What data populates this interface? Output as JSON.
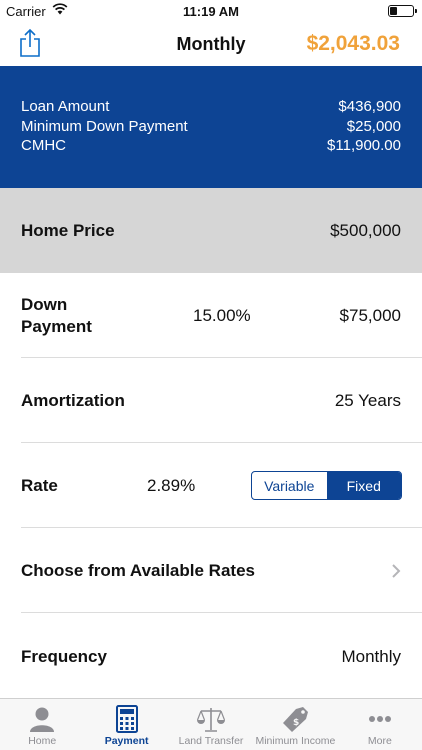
{
  "status_bar": {
    "carrier": "Carrier",
    "time": "11:19 AM",
    "battery_level": 0.3
  },
  "nav": {
    "share_icon": "share-icon",
    "title": "Monthly",
    "payment": "$2,043.03",
    "payment_color": "#f0a23a"
  },
  "summary": {
    "background": "#0d4494",
    "rows": [
      {
        "label": "Loan Amount",
        "value": "$436,900"
      },
      {
        "label": "Minimum Down Payment",
        "value": "$25,000"
      },
      {
        "label": "CMHC",
        "value": "$11,900.00"
      }
    ]
  },
  "home_price": {
    "label": "Home Price",
    "value": "$500,000"
  },
  "down_payment": {
    "label": "Down Payment",
    "percent": "15.00%",
    "value": "$75,000"
  },
  "amortization": {
    "label": "Amortization",
    "value": "25 Years"
  },
  "rate": {
    "label": "Rate",
    "value": "2.89%",
    "options": [
      "Variable",
      "Fixed"
    ],
    "selected": "Fixed"
  },
  "available_rates": {
    "label": "Choose from Available Rates",
    "icon": "chevron-right-icon"
  },
  "frequency": {
    "label": "Frequency",
    "value": "Monthly"
  },
  "tabs": [
    {
      "label": "Home",
      "icon": "person-icon",
      "active": false
    },
    {
      "label": "Payment",
      "icon": "calculator-icon",
      "active": true
    },
    {
      "label": "Land Transfer",
      "icon": "scales-icon",
      "active": false
    },
    {
      "label": "Minimum Income",
      "icon": "price-tag-icon",
      "active": false
    },
    {
      "label": "More",
      "icon": "more-icon",
      "active": false
    }
  ]
}
